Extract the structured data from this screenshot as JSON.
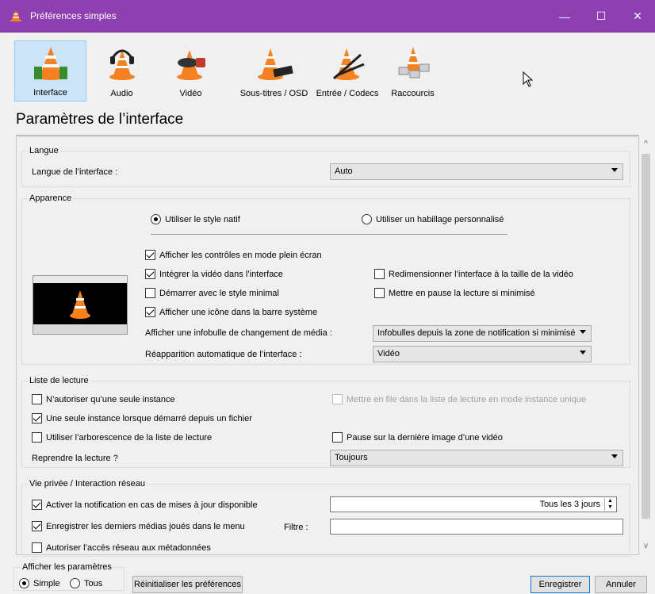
{
  "window": {
    "title": "Préférences simples",
    "minimize": "—",
    "maximize": "☐",
    "close": "✕"
  },
  "tabs": [
    {
      "label": "Interface",
      "icon": "vlc-interface-icon",
      "selected": true
    },
    {
      "label": "Audio",
      "icon": "vlc-audio-icon"
    },
    {
      "label": "Vidéo",
      "icon": "vlc-video-icon"
    },
    {
      "label": "Sous-titres / OSD",
      "icon": "vlc-subtitles-icon"
    },
    {
      "label": "Entrée / Codecs",
      "icon": "vlc-codecs-icon"
    },
    {
      "label": "Raccourcis",
      "icon": "vlc-hotkeys-icon"
    }
  ],
  "heading": "Paramètres de l’interface",
  "langue": {
    "title": "Langue",
    "label": "Langue de l’interface :",
    "value": "Auto"
  },
  "apparence": {
    "title": "Apparence",
    "radio_native": "Utiliser le style natif",
    "radio_skin": "Utiliser un habillage personnalisé",
    "cb_fullscreen": "Afficher les contrôles en mode plein écran",
    "cb_integrate": "Intégrer la vidéo dans l’interface",
    "cb_resize": "Redimensionner l’interface à la taille de la vidéo",
    "cb_minimal": "Démarrer avec le style minimal",
    "cb_pause_min": "Mettre en pause la lecture si minimisé",
    "cb_systray": "Afficher une icône dans la barre système",
    "infobulle_label": "Afficher une infobulle de changement de média :",
    "infobulle_value": "Infobulles depuis la zone de notification si minimisé",
    "reappear_label": "Réapparition automatique de l’interface :",
    "reappear_value": "Vidéo"
  },
  "playlist": {
    "title": "Liste de lecture",
    "cb_one_instance": "N’autoriser qu’une seule instance",
    "cb_enqueue": "Mettre en file dans la liste de lecture en mode instance unique",
    "cb_one_from_file": "Une seule instance lorsque démarré depuis un fichier",
    "cb_tree": "Utiliser l’arborescence de la liste de lecture",
    "cb_pause_last": "Pause sur la dernière image d’une vidéo",
    "resume_label": "Reprendre la lecture ?",
    "resume_value": "Toujours"
  },
  "privacy": {
    "title": "Vie privée / Interaction réseau",
    "cb_updates": "Activer la notification en cas de mises à jour disponible",
    "updates_interval": "Tous les 3 jours",
    "cb_recent": "Enregistrer les derniers médias joués dans le menu",
    "filter_label": "Filtre :",
    "filter_value": "",
    "cb_metadata": "Autoriser l’accès réseau aux métadonnées"
  },
  "footer": {
    "show_title": "Afficher les paramètres",
    "simple": "Simple",
    "all": "Tous",
    "reset": "Réinitialiser les préférences",
    "save": "Enregistrer",
    "cancel": "Annuler"
  }
}
